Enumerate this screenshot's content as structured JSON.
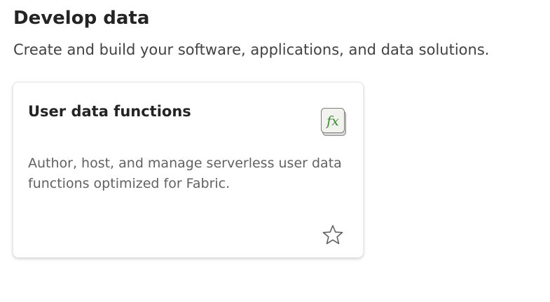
{
  "section": {
    "title": "Develop data",
    "subtitle": "Create and build your software, applications, and data solutions."
  },
  "cards": [
    {
      "title": "User data functions",
      "description": "Author, host, and manage serverless user data functions optimized for Fabric.",
      "icon": "fx-function-icon",
      "icon_glyph": "fx",
      "favorite_icon": "star-outline-icon",
      "colors": {
        "icon_accent": "#3a8a2e"
      }
    }
  ]
}
